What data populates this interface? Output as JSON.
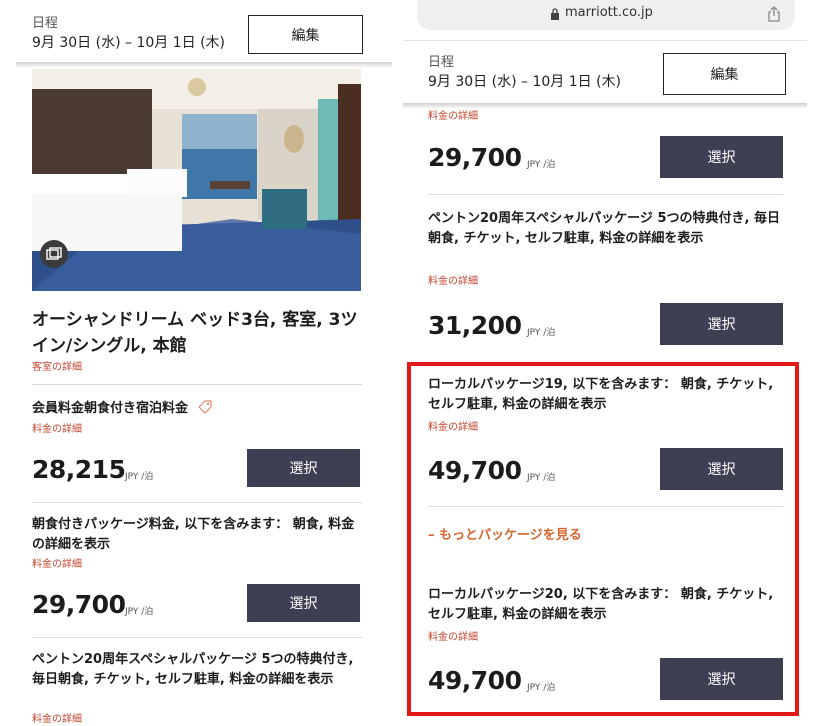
{
  "left": {
    "header": {
      "date_label": "日程",
      "date_value": "9月 30日 (水) – 10月 1日 (木)",
      "edit_label": "編集"
    },
    "room": {
      "title": "オーシャンドリーム ベッド3台, 客室, 3ツイン/シングル, 本館",
      "detail_link": "客室の詳細"
    },
    "rates": [
      {
        "title": "会員料金朝食付き宿泊料金",
        "detail_link": "料金の詳細",
        "price": "28,215",
        "unit": "JPY /泊",
        "button": "選択"
      },
      {
        "title": "朝食付きパッケージ料金, 以下を含みます： 朝食, 料金の詳細を表示",
        "detail_link": "料金の詳細",
        "price": "29,700",
        "unit": "JPY /泊",
        "button": "選択"
      },
      {
        "title": "ペントン20周年スペシャルパッケージ 5つの特典付き, 毎日朝食, チケット, セルフ駐車, 料金の詳細を表示",
        "detail_link": "料金の詳細"
      }
    ]
  },
  "right": {
    "url": "marriott.co.jp",
    "header": {
      "date_label": "日程",
      "date_value": "9月 30日 (水) – 10月 1日 (木)",
      "edit_label": "編集"
    },
    "top_detail_link": "料金の詳細",
    "rates": [
      {
        "price": "29,700",
        "unit": "JPY /泊",
        "button": "選択"
      },
      {
        "title": "ペントン20周年スペシャルパッケージ 5つの特典付き, 毎日朝食, チケット, セルフ駐車, 料金の詳細を表示",
        "detail_link": "料金の詳細",
        "price": "31,200",
        "unit": "JPY /泊",
        "button": "選択"
      },
      {
        "title": "ローカルパッケージ19, 以下を含みます： 朝食, チケット, セルフ駐車, 料金の詳細を表示",
        "detail_link": "料金の詳細",
        "price": "49,700",
        "unit": "JPY /泊",
        "button": "選択"
      },
      {
        "title": "ローカルパッケージ20, 以下を含みます： 朝食, チケット, セルフ駐車, 料金の詳細を表示",
        "detail_link": "料金の詳細",
        "price": "49,700",
        "unit": "JPY /泊",
        "button": "選択"
      }
    ],
    "more_packages": "– もっとパッケージを見る"
  },
  "colors": {
    "button_bg": "#3f3f54",
    "link": "#c2452d",
    "more_link": "#d7652f",
    "highlight": "#e31919"
  },
  "icons": [
    "gallery-icon",
    "lock-icon",
    "share-icon",
    "tag-icon"
  ]
}
